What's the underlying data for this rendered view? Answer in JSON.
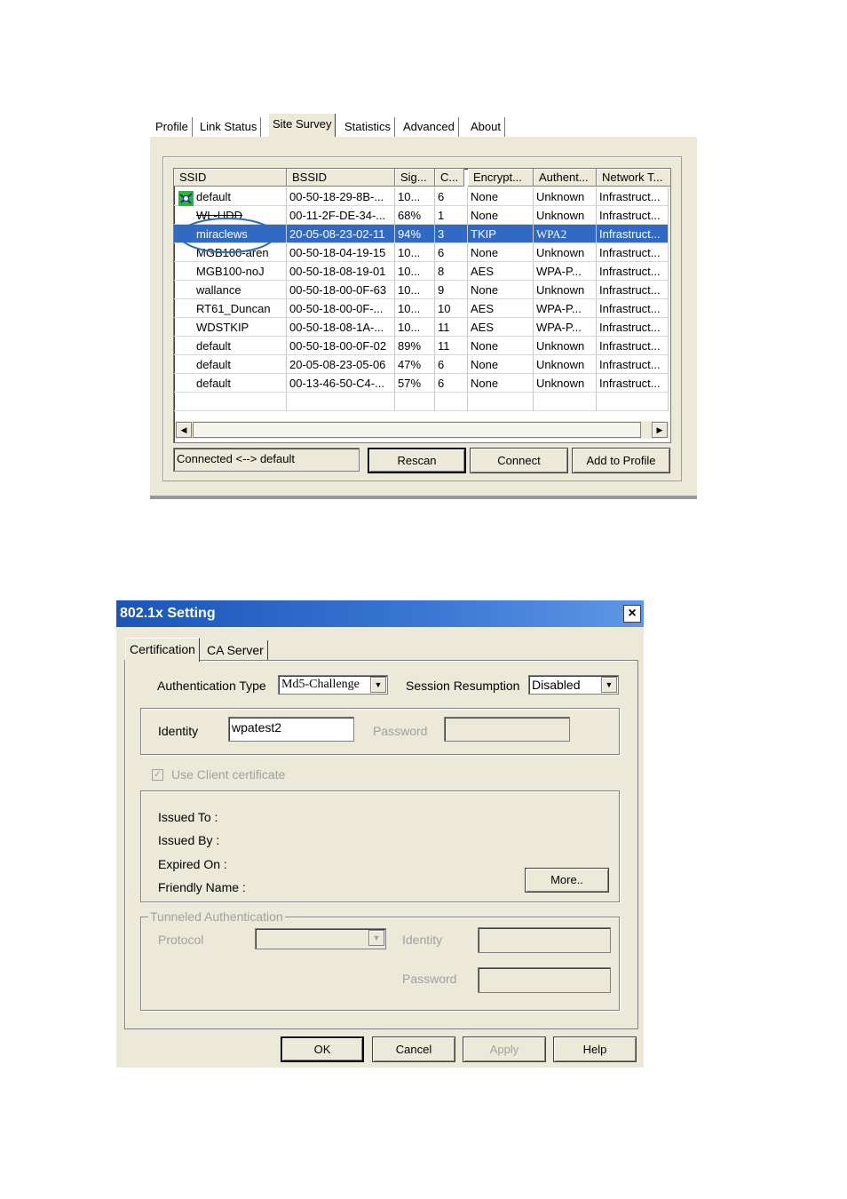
{
  "survey": {
    "tabs": [
      "Profile",
      "Link Status",
      "Site Survey",
      "Statistics",
      "Advanced",
      "About"
    ],
    "active_tab": "Site Survey",
    "columns": [
      "SSID",
      "BSSID",
      "Sig...",
      "C...",
      "Encrypt...",
      "Authent...",
      "Network T..."
    ],
    "rows": [
      {
        "ssid": "default",
        "bssid": "00-50-18-29-8B-...",
        "signal": "10...",
        "channel": "6",
        "encrypt": "None",
        "auth": "Unknown",
        "network": "Infrastruct...",
        "connected": true
      },
      {
        "ssid": "WL-HDD",
        "bssid": "00-11-2F-DE-34-...",
        "signal": "68%",
        "channel": "1",
        "encrypt": "None",
        "auth": "Unknown",
        "network": "Infrastruct..."
      },
      {
        "ssid": "miraclews",
        "bssid": "20-05-08-23-02-11",
        "signal": "94%",
        "channel": "3",
        "encrypt": "TKIP",
        "auth": "WPA2",
        "network": "Infrastruct...",
        "selected": true
      },
      {
        "ssid": "MGB100-aren",
        "bssid": "00-50-18-04-19-15",
        "signal": "10...",
        "channel": "6",
        "encrypt": "None",
        "auth": "Unknown",
        "network": "Infrastruct..."
      },
      {
        "ssid": "MGB100-noJ",
        "bssid": "00-50-18-08-19-01",
        "signal": "10...",
        "channel": "8",
        "encrypt": "AES",
        "auth": "WPA-P...",
        "network": "Infrastruct..."
      },
      {
        "ssid": "wallance",
        "bssid": "00-50-18-00-0F-63",
        "signal": "10...",
        "channel": "9",
        "encrypt": "None",
        "auth": "Unknown",
        "network": "Infrastruct..."
      },
      {
        "ssid": "RT61_Duncan",
        "bssid": "00-50-18-00-0F-...",
        "signal": "10...",
        "channel": "10",
        "encrypt": "AES",
        "auth": "WPA-P...",
        "network": "Infrastruct..."
      },
      {
        "ssid": "WDSTKIP",
        "bssid": "00-50-18-08-1A-...",
        "signal": "10...",
        "channel": "11",
        "encrypt": "AES",
        "auth": "WPA-P...",
        "network": "Infrastruct..."
      },
      {
        "ssid": "default",
        "bssid": "00-50-18-00-0F-02",
        "signal": "89%",
        "channel": "11",
        "encrypt": "None",
        "auth": "Unknown",
        "network": "Infrastruct..."
      },
      {
        "ssid": "default",
        "bssid": "20-05-08-23-05-06",
        "signal": "47%",
        "channel": "6",
        "encrypt": "None",
        "auth": "Unknown",
        "network": "Infrastruct..."
      },
      {
        "ssid": "default",
        "bssid": "00-13-46-50-C4-...",
        "signal": "57%",
        "channel": "6",
        "encrypt": "None",
        "auth": "Unknown",
        "network": "Infrastruct..."
      }
    ],
    "status_text": "Connected <--> default",
    "buttons": {
      "rescan": "Rescan",
      "connect": "Connect",
      "add_profile": "Add to Profile"
    },
    "scroll_left_icon": "scroll-left-arrow",
    "scroll_right_icon": "scroll-right-arrow",
    "highlight_color": "#316ac5",
    "circle_color": "#2a6fb4"
  },
  "dialog": {
    "title": "802.1x Setting",
    "close_label": "×",
    "tabs": [
      "Certification",
      "CA Server"
    ],
    "active_tab": "Certification",
    "auth_type_label": "Authentication Type",
    "auth_type_value": "Md5-Challenge",
    "session_label": "Session Resumption",
    "session_value": "Disabled",
    "identity_label": "Identity",
    "identity_value": "wpatest2",
    "password_label": "Password",
    "use_client_cert_label": "Use Client certificate",
    "use_client_cert_checked": true,
    "cert_fields": [
      "Issued To :",
      "Issued By :",
      "Expired On :",
      "Friendly Name :"
    ],
    "more_button": "More..",
    "tunneled": {
      "legend": "Tunneled Authentication",
      "protocol_label": "Protocol",
      "identity_label": "Identity",
      "password_label": "Password"
    },
    "buttons": {
      "ok": "OK",
      "cancel": "Cancel",
      "apply": "Apply",
      "help": "Help"
    },
    "titlebar_color": "#1a55b8"
  }
}
